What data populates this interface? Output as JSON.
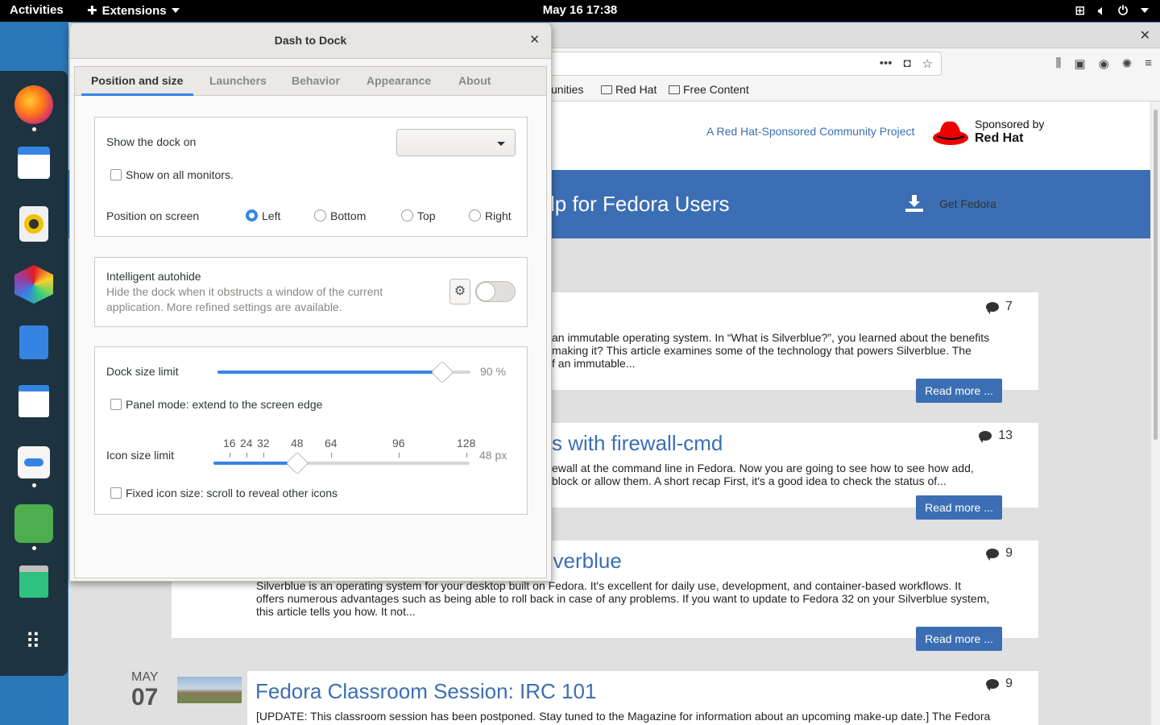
{
  "topbar": {
    "activities": "Activities",
    "extensions_menu": "Extensions",
    "clock": "May 16  17:38"
  },
  "browser": {
    "bookmarks": [
      "unities",
      "Red Hat",
      "Free Content"
    ],
    "sponsor_text": "A Red Hat-Sponsored Community Project",
    "sponsored_by": "Sponsored by",
    "red_hat": "Red Hat",
    "nav_help": "lp for Fedora Users",
    "nav_get": "Get Fedora",
    "read_more": "Read more ...",
    "articles": [
      {
        "title": "",
        "excerpt": [
          "an immutable operating system. In “What is Silverblue?”, you learned about the benefits",
          "making it? This article examines some of the technology that powers Silverblue. The",
          "f an immutable..."
        ],
        "comments": "7"
      },
      {
        "title": "s with firewall-cmd",
        "excerpt": [
          "ewall at the command line in Fedora. Now you are going to see how to see how add,",
          " block or allow them. A short recap First, it's a good idea to check the status of..."
        ],
        "comments": "13"
      },
      {
        "title": "ilverblue",
        "excerpt": [
          "Silverblue is an operating system for your desktop built on Fedora. It's excellent for daily use, development, and container-based workflows. It",
          "offers numerous advantages such as being able to roll back in case of any problems. If you want to update to Fedora 32 on your Silverblue system,",
          "this article tells you how. It not..."
        ],
        "comments": "9"
      },
      {
        "title": "Fedora Classroom Session: IRC 101",
        "excerpt": [
          "[UPDATE: This classroom session has been postponed. Stay tuned to the Magazine for information about an upcoming make-up date.] The Fedora"
        ],
        "comments": "9",
        "date_month": "MAY",
        "date_day": "07"
      }
    ]
  },
  "dialog": {
    "title": "Dash to Dock",
    "tabs": [
      "Position and size",
      "Launchers",
      "Behavior",
      "Appearance",
      "About"
    ],
    "active_tab": "Position and size",
    "position": {
      "show_dock_on": "Show the dock on",
      "show_dock_on_value": "",
      "show_all_monitors": "Show on all monitors.",
      "show_all_monitors_checked": false,
      "position_on_screen": "Position on screen",
      "options": [
        "Left",
        "Bottom",
        "Top",
        "Right"
      ],
      "selected": "Left"
    },
    "autohide": {
      "title": "Intelligent autohide",
      "description_1": "Hide the dock when it obstructs a window of the current",
      "description_2": "application. More refined settings are available.",
      "enabled": false
    },
    "size": {
      "dock_size_limit": "Dock size limit",
      "dock_size_value": "90 %",
      "dock_size_fraction": 0.9,
      "panel_mode": "Panel mode: extend to the screen edge",
      "panel_mode_checked": false,
      "icon_size_limit": "Icon size limit",
      "icon_size_ticks": [
        "16",
        "24",
        "32",
        "48",
        "64",
        "96",
        "128"
      ],
      "icon_size_value": "48 px",
      "icon_size_px": 48,
      "fixed_icon_size": "Fixed icon size: scroll to reveal other icons",
      "fixed_icon_size_checked": false
    }
  },
  "dock": {
    "icons": [
      "firefox-icon",
      "calendar-icon",
      "rhythmbox-icon",
      "software-hexagon-icon",
      "files-icon",
      "software-store-icon",
      "tweaks-icon",
      "extensions-puzzle-icon",
      "trash-icon",
      "app-grid-icon"
    ]
  }
}
